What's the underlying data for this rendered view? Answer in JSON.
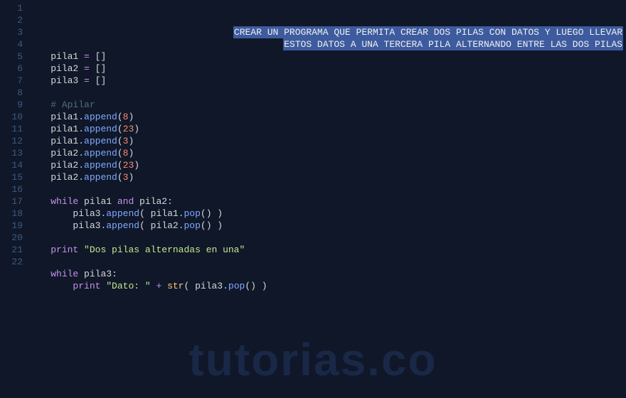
{
  "editor": {
    "lines": [
      {
        "n": 1,
        "type": "highlight1"
      },
      {
        "n": 2,
        "type": "highlight2"
      },
      {
        "n": 3,
        "type": "assign",
        "var": "pila1"
      },
      {
        "n": 4,
        "type": "assign",
        "var": "pila2"
      },
      {
        "n": 5,
        "type": "assign",
        "var": "pila3"
      },
      {
        "n": 6,
        "type": "empty"
      },
      {
        "n": 7,
        "type": "comment"
      },
      {
        "n": 8,
        "type": "append",
        "var": "pila1",
        "val": "8"
      },
      {
        "n": 9,
        "type": "append",
        "var": "pila1",
        "val": "23"
      },
      {
        "n": 10,
        "type": "append",
        "var": "pila1",
        "val": "3"
      },
      {
        "n": 11,
        "type": "append",
        "var": "pila2",
        "val": "8"
      },
      {
        "n": 12,
        "type": "append",
        "var": "pila2",
        "val": "23"
      },
      {
        "n": 13,
        "type": "append",
        "var": "pila2",
        "val": "3"
      },
      {
        "n": 14,
        "type": "empty"
      },
      {
        "n": 15,
        "type": "while_and"
      },
      {
        "n": 16,
        "type": "pop_append",
        "src": "pila1"
      },
      {
        "n": 17,
        "type": "pop_append",
        "src": "pila2"
      },
      {
        "n": 18,
        "type": "empty"
      },
      {
        "n": 19,
        "type": "print1"
      },
      {
        "n": 20,
        "type": "empty"
      },
      {
        "n": 21,
        "type": "while_single"
      },
      {
        "n": 22,
        "type": "print2"
      }
    ]
  },
  "text": {
    "highlight1": "CREAR UN PROGRAMA QUE PERMITA CREAR DOS PILAS CON DATOS Y LUEGO LLEVAR",
    "highlight2": "ESTOS DATOS A UNA TERCERA PILA ALTERNANDO ENTRE LAS DOS PILAS",
    "comment": "# Apilar",
    "eq": " = ",
    "empty_list": "[]",
    "append": "append",
    "pop": "pop",
    "while": "while",
    "and": "and",
    "while_cond1_a": " pila1 ",
    "while_cond1_b": " pila2:",
    "while_cond2": " pila3:",
    "pila3_append_open": "pila3.append( ",
    "pila3_append_close": ".pop() )",
    "print": "print",
    "str": "str",
    "string1": "\"Dos pilas alternadas en una\"",
    "string2_a": "\"Dato: \"",
    "plus": " + ",
    "str_open": "( pila3.",
    "str_close": "() )"
  },
  "watermark": "tutorias.co"
}
